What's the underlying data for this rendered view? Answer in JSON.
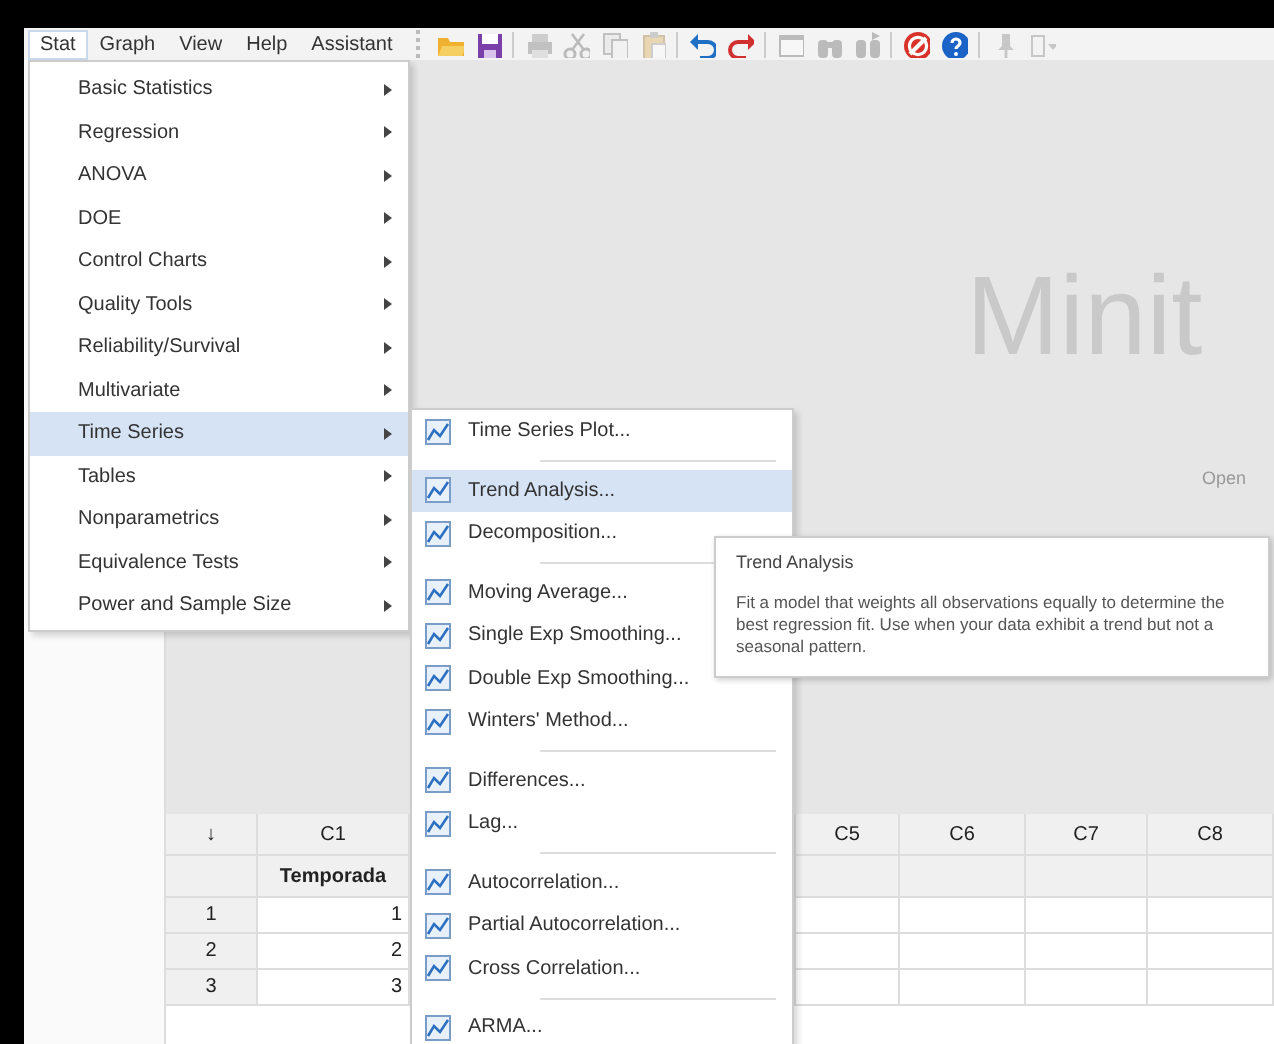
{
  "menubar": [
    {
      "label": "Stat",
      "selected": true
    },
    {
      "label": "Graph",
      "selected": false
    },
    {
      "label": "View",
      "selected": false
    },
    {
      "label": "Help",
      "selected": false
    },
    {
      "label": "Assistant",
      "selected": false
    }
  ],
  "toolbar": [
    {
      "kind": "open",
      "disabled": false
    },
    {
      "kind": "save",
      "disabled": false
    },
    {
      "kind": "print",
      "disabled": true
    },
    {
      "kind": "cut",
      "disabled": true
    },
    {
      "kind": "copy",
      "disabled": true
    },
    {
      "kind": "paste",
      "disabled": true
    },
    {
      "kind": "undo",
      "disabled": false
    },
    {
      "kind": "redo",
      "disabled": false
    },
    {
      "kind": "window",
      "disabled": true
    },
    {
      "kind": "find",
      "disabled": true
    },
    {
      "kind": "find-next",
      "disabled": true
    },
    {
      "kind": "stop",
      "disabled": false
    },
    {
      "kind": "help",
      "disabled": false
    },
    {
      "kind": "pin",
      "disabled": true
    },
    {
      "kind": "more",
      "disabled": true
    }
  ],
  "stat_menu": {
    "items": [
      {
        "label": "Basic Statistics",
        "selected": false
      },
      {
        "label": "Regression",
        "selected": false
      },
      {
        "label": "ANOVA",
        "selected": false
      },
      {
        "label": "DOE",
        "selected": false
      },
      {
        "label": "Control Charts",
        "selected": false
      },
      {
        "label": "Quality Tools",
        "selected": false
      },
      {
        "label": "Reliability/Survival",
        "selected": false
      },
      {
        "label": "Multivariate",
        "selected": false
      },
      {
        "label": "Time Series",
        "selected": true
      },
      {
        "label": "Tables",
        "selected": false
      },
      {
        "label": "Nonparametrics",
        "selected": false
      },
      {
        "label": "Equivalence Tests",
        "selected": false
      },
      {
        "label": "Power and Sample Size",
        "selected": false
      }
    ]
  },
  "time_series_menu": {
    "items": [
      {
        "label": "Time Series Plot...",
        "selected": false,
        "separator_after": true
      },
      {
        "label": "Trend Analysis...",
        "selected": true,
        "separator_after": false
      },
      {
        "label": "Decomposition...",
        "selected": false,
        "separator_after": true
      },
      {
        "label": "Moving Average...",
        "selected": false,
        "separator_after": false
      },
      {
        "label": "Single Exp Smoothing...",
        "selected": false,
        "separator_after": false
      },
      {
        "label": "Double Exp Smoothing...",
        "selected": false,
        "separator_after": false
      },
      {
        "label": "Winters' Method...",
        "selected": false,
        "separator_after": true
      },
      {
        "label": "Differences...",
        "selected": false,
        "separator_after": false
      },
      {
        "label": "Lag...",
        "selected": false,
        "separator_after": true
      },
      {
        "label": "Autocorrelation...",
        "selected": false,
        "separator_after": false
      },
      {
        "label": "Partial Autocorrelation...",
        "selected": false,
        "separator_after": false
      },
      {
        "label": "Cross Correlation...",
        "selected": false,
        "separator_after": true
      },
      {
        "label": "ARMA...",
        "selected": false,
        "separator_after": false
      }
    ]
  },
  "tooltip": {
    "title": "Trend Analysis",
    "text": "Fit a model that weights all observations equally to determine the best regression fit. Use when your data exhibit a trend but not a seasonal pattern."
  },
  "start_page": {
    "logo": "Minit",
    "open_label": "Open"
  },
  "worksheet": {
    "corner": "↓",
    "columns": [
      {
        "label": "C1",
        "name": "Temporada"
      },
      {
        "label": "C5"
      },
      {
        "label": "C6"
      },
      {
        "label": "C7"
      },
      {
        "label": "C8"
      }
    ],
    "rows": [
      {
        "number": "1",
        "cells": [
          "1"
        ]
      },
      {
        "number": "2",
        "cells": [
          "2"
        ]
      },
      {
        "number": "3",
        "cells": [
          "3"
        ]
      }
    ]
  }
}
